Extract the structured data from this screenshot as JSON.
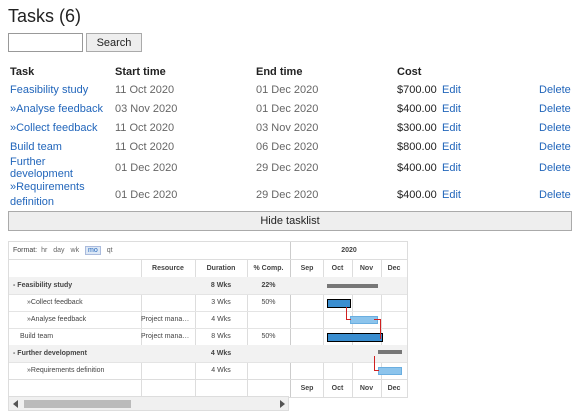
{
  "page": {
    "title": "Tasks (6)"
  },
  "search": {
    "button_label": "Search",
    "value": "",
    "placeholder": ""
  },
  "table": {
    "headers": {
      "task": "Task",
      "start": "Start time",
      "end": "End time",
      "cost": "Cost"
    },
    "action_edit": "Edit",
    "action_delete": "Delete",
    "rows": [
      {
        "task": "Feasibility study",
        "start": "11 Oct 2020",
        "end": "01 Dec 2020",
        "cost": "$700.00"
      },
      {
        "task": "»Analyse feedback",
        "start": "03 Nov 2020",
        "end": "01 Dec 2020",
        "cost": "$400.00"
      },
      {
        "task": "»Collect feedback",
        "start": "11 Oct 2020",
        "end": "03 Nov 2020",
        "cost": "$300.00"
      },
      {
        "task": "Build team",
        "start": "11 Oct 2020",
        "end": "06 Dec 2020",
        "cost": "$800.00"
      },
      {
        "task": "Further development",
        "start": "01 Dec 2020",
        "end": "29 Dec 2020",
        "cost": "$400.00"
      },
      {
        "task": "»Requirements",
        "task_line2": "definition",
        "start": "01 Dec 2020",
        "end": "29 Dec 2020",
        "cost": "$400.00"
      }
    ]
  },
  "hide_tasklist_label": "Hide tasklist",
  "gantt": {
    "format_label": "Format:",
    "formats": [
      "hr",
      "day",
      "wk",
      "mo",
      "qt"
    ],
    "selected_format": "mo",
    "year": "2020",
    "columns": {
      "resource": "Resource",
      "duration": "Duration",
      "pct": "% Comp."
    },
    "months": [
      "Sep",
      "Oct",
      "Nov",
      "Dec"
    ],
    "rows": [
      {
        "name": "Feasibility study",
        "resource": "",
        "duration": "8 Wks",
        "pct": "22%",
        "group": true
      },
      {
        "name": "»Collect feedback",
        "resource": "",
        "duration": "3 Wks",
        "pct": "50%",
        "group": false
      },
      {
        "name": "»Analyse feedback",
        "resource": "Project mana…",
        "duration": "4 Wks",
        "pct": "",
        "group": false
      },
      {
        "name": "Build team",
        "resource": "Project mana…",
        "duration": "8 Wks",
        "pct": "50%",
        "group": false
      },
      {
        "name": "Further development",
        "resource": "",
        "duration": "4 Wks",
        "pct": "",
        "group": true
      },
      {
        "name": "»Requirements definition",
        "resource": "",
        "duration": "4 Wks",
        "pct": "",
        "group": false
      }
    ]
  }
}
